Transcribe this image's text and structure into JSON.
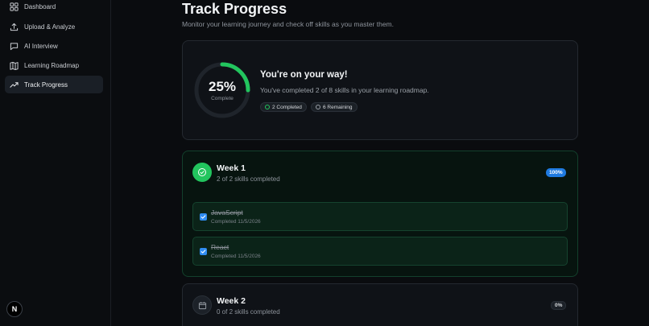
{
  "sidebar": {
    "items": [
      {
        "label": "Dashboard",
        "icon": "grid-icon"
      },
      {
        "label": "Upload & Analyze",
        "icon": "upload-icon"
      },
      {
        "label": "AI Interview",
        "icon": "chat-icon"
      },
      {
        "label": "Learning Roadmap",
        "icon": "map-icon"
      },
      {
        "label": "Track Progress",
        "icon": "trending-up-icon",
        "active": true
      }
    ],
    "logo_letter": "N"
  },
  "page": {
    "title": "Track Progress",
    "subtitle": "Monitor your learning journey and check off skills as you master them."
  },
  "summary": {
    "percent": 25,
    "percent_label": "25%",
    "ring_label": "Complete",
    "heading": "You're on your way!",
    "text": "You've completed 2 of 8 skills in your learning roadmap.",
    "completed_pill": "2 Completed",
    "remaining_pill": "6 Remaining"
  },
  "weeks": [
    {
      "title": "Week 1",
      "subtitle": "2 of 2 skills completed",
      "badge": "100%",
      "skills": [
        {
          "name": "JavaScript",
          "date": "Completed 11/5/2026",
          "checked": true
        },
        {
          "name": "React",
          "date": "Completed 11/5/2026",
          "checked": true
        }
      ]
    },
    {
      "title": "Week 2",
      "subtitle": "0 of 2 skills completed",
      "badge": "0%"
    }
  ],
  "colors": {
    "accent_green": "#22c55e",
    "accent_blue": "#2f8cf0",
    "ring_track": "#1f242b"
  }
}
